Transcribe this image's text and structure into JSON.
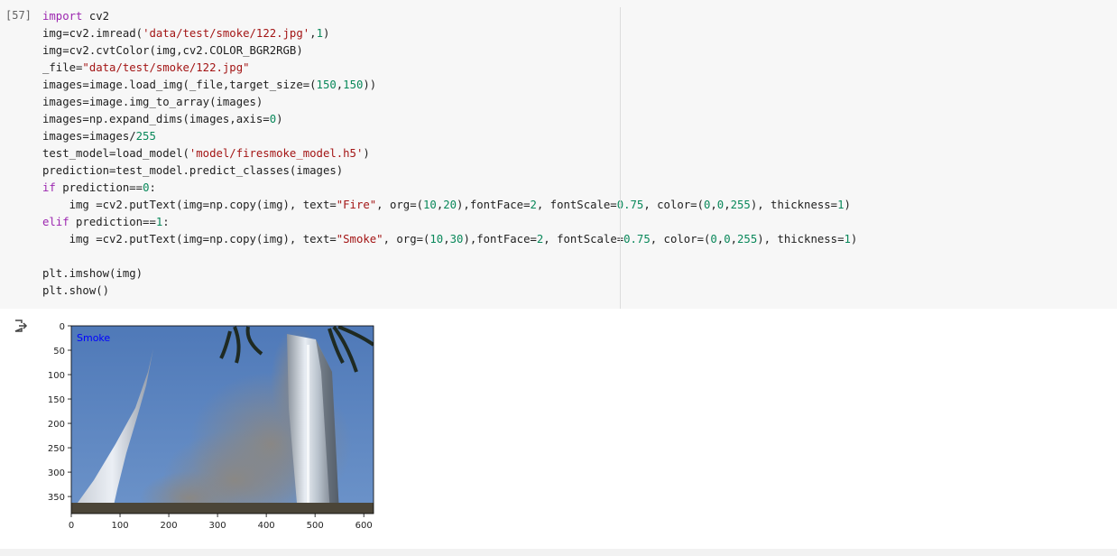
{
  "cell": {
    "execution_count": "[57]",
    "code_lines": [
      [
        [
          "kw",
          "import"
        ],
        [
          "t",
          " cv2"
        ]
      ],
      [
        [
          "t",
          "img=cv2.imread("
        ],
        [
          "str",
          "'data/test/smoke/122.jpg'"
        ],
        [
          "t",
          ","
        ],
        [
          "num",
          "1"
        ],
        [
          "t",
          ")"
        ]
      ],
      [
        [
          "t",
          "img=cv2.cvtColor(img,cv2.COLOR_BGR2RGB)"
        ]
      ],
      [
        [
          "t",
          "_file="
        ],
        [
          "str",
          "\"data/test/smoke/122.jpg\""
        ]
      ],
      [
        [
          "t",
          "images=image.load_img(_file,target_size=("
        ],
        [
          "num",
          "150"
        ],
        [
          "t",
          ","
        ],
        [
          "num",
          "150"
        ],
        [
          "t",
          "))"
        ]
      ],
      [
        [
          "t",
          "images=image.img_to_array(images)"
        ]
      ],
      [
        [
          "t",
          "images=np.expand_dims(images,axis="
        ],
        [
          "num",
          "0"
        ],
        [
          "t",
          ")"
        ]
      ],
      [
        [
          "t",
          "images=images/"
        ],
        [
          "num",
          "255"
        ]
      ],
      [
        [
          "t",
          "test_model=load_model("
        ],
        [
          "str",
          "'model/firesmoke_model.h5'"
        ],
        [
          "t",
          ")"
        ]
      ],
      [
        [
          "t",
          "prediction=test_model.predict_classes(images)"
        ]
      ],
      [
        [
          "kw",
          "if"
        ],
        [
          "t",
          " prediction=="
        ],
        [
          "num",
          "0"
        ],
        [
          "t",
          ":"
        ]
      ],
      [
        [
          "t",
          "    img =cv2.putText(img=np.copy(img), text="
        ],
        [
          "str",
          "\"Fire\""
        ],
        [
          "t",
          ", org=("
        ],
        [
          "num",
          "10"
        ],
        [
          "t",
          ","
        ],
        [
          "num",
          "20"
        ],
        [
          "t",
          "),fontFace="
        ],
        [
          "num",
          "2"
        ],
        [
          "t",
          ", fontScale="
        ],
        [
          "num",
          "0.75"
        ],
        [
          "t",
          ", color=("
        ],
        [
          "num",
          "0"
        ],
        [
          "t",
          ","
        ],
        [
          "num",
          "0"
        ],
        [
          "t",
          ","
        ],
        [
          "num",
          "255"
        ],
        [
          "t",
          "), thickness="
        ],
        [
          "num",
          "1"
        ],
        [
          "t",
          ")"
        ]
      ],
      [
        [
          "kw",
          "elif"
        ],
        [
          "t",
          " prediction=="
        ],
        [
          "num",
          "1"
        ],
        [
          "t",
          ":"
        ]
      ],
      [
        [
          "t",
          "    img =cv2.putText(img=np.copy(img), text="
        ],
        [
          "str",
          "\"Smoke\""
        ],
        [
          "t",
          ", org=("
        ],
        [
          "num",
          "10"
        ],
        [
          "t",
          ","
        ],
        [
          "num",
          "30"
        ],
        [
          "t",
          "),fontFace="
        ],
        [
          "num",
          "2"
        ],
        [
          "t",
          ", fontScale="
        ],
        [
          "num",
          "0.75"
        ],
        [
          "t",
          ", color=("
        ],
        [
          "num",
          "0"
        ],
        [
          "t",
          ","
        ],
        [
          "num",
          "0"
        ],
        [
          "t",
          ","
        ],
        [
          "num",
          "255"
        ],
        [
          "t",
          "), thickness="
        ],
        [
          "num",
          "1"
        ],
        [
          "t",
          ")"
        ]
      ],
      [
        [
          "t",
          ""
        ]
      ],
      [
        [
          "t",
          "plt.imshow(img)"
        ]
      ],
      [
        [
          "t",
          "plt.show()"
        ]
      ]
    ]
  },
  "output": {
    "icon": "output-arrow-icon",
    "image_overlay_text": "Smoke",
    "y_ticks": [
      "0",
      "50",
      "100",
      "150",
      "200",
      "250",
      "300",
      "350"
    ],
    "x_ticks": [
      "0",
      "100",
      "200",
      "300",
      "400",
      "500",
      "600"
    ]
  },
  "colors": {
    "cell_bg": "#f7f7f7",
    "keyword": "#9c27b0",
    "string": "#a31515",
    "number": "#09885a",
    "overlay_text": "#0000ff"
  }
}
